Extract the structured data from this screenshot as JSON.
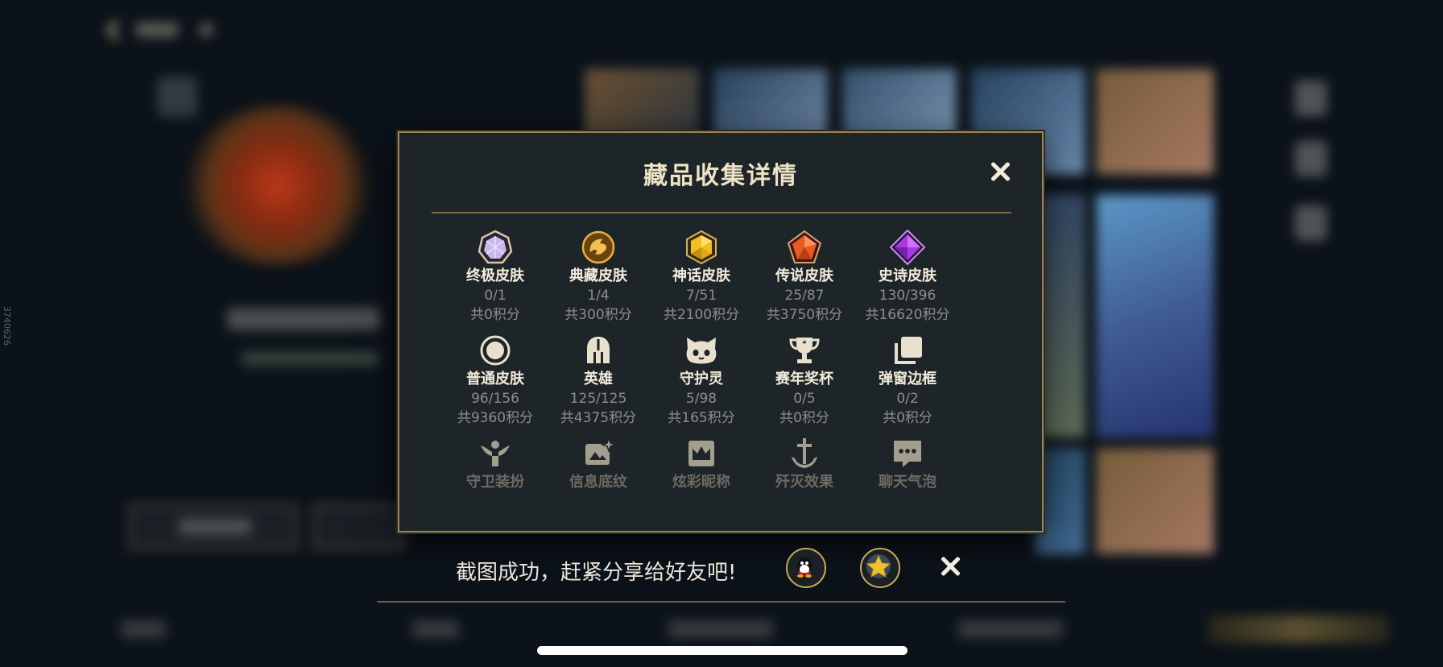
{
  "modal": {
    "title": "藏品收集详情",
    "close_icon": "close-icon"
  },
  "collections": [
    {
      "name": "终极皮肤",
      "count": "0/1",
      "points": "共0积分",
      "icon": "diamond-gem-icon",
      "color": "#c8b8e8"
    },
    {
      "name": "典藏皮肤",
      "count": "1/4",
      "points": "共300积分",
      "icon": "dragon-emblem-icon",
      "color": "#d8a030"
    },
    {
      "name": "神话皮肤",
      "count": "7/51",
      "points": "共2100积分",
      "icon": "gold-hexagon-gem-icon",
      "color": "#e8b830"
    },
    {
      "name": "传说皮肤",
      "count": "25/87",
      "points": "共3750积分",
      "icon": "orange-pentagon-gem-icon",
      "color": "#e86030"
    },
    {
      "name": "史诗皮肤",
      "count": "130/396",
      "points": "共16620积分",
      "icon": "purple-diamond-gem-icon",
      "color": "#b040e0"
    },
    {
      "name": "普通皮肤",
      "count": "96/156",
      "points": "共9360积分",
      "icon": "circle-ring-icon",
      "color": "#e8e0cc"
    },
    {
      "name": "英雄",
      "count": "125/125",
      "points": "共4375积分",
      "icon": "helmet-icon",
      "color": "#e8e0cc"
    },
    {
      "name": "守护灵",
      "count": "5/98",
      "points": "共165积分",
      "icon": "cat-face-icon",
      "color": "#e8e0cc"
    },
    {
      "name": "赛年奖杯",
      "count": "0/5",
      "points": "共0积分",
      "icon": "trophy-icon",
      "color": "#e8e0cc"
    },
    {
      "name": "弹窗边框",
      "count": "0/2",
      "points": "共0积分",
      "icon": "stacked-frames-icon",
      "color": "#e8e0cc"
    },
    {
      "name": "守卫装扮",
      "icon": "winged-guardian-icon",
      "color": "#d0c8b0"
    },
    {
      "name": "信息底纹",
      "icon": "card-sparkle-icon",
      "color": "#d0c8b0"
    },
    {
      "name": "炫彩昵称",
      "icon": "crown-card-icon",
      "color": "#d0c8b0"
    },
    {
      "name": "歼灭效果",
      "icon": "anchor-sword-icon",
      "color": "#d0c8b0"
    },
    {
      "name": "聊天气泡",
      "icon": "chat-bubble-icon",
      "color": "#d0c8b0"
    }
  ],
  "share_bar": {
    "message": "截图成功，赶紧分享给好友吧!",
    "qq_icon": "qq-penguin-icon",
    "favorite_icon": "star-badge-icon",
    "close_icon": "close-icon"
  },
  "side_id": "3740626",
  "accent_gold": "#9a8454"
}
